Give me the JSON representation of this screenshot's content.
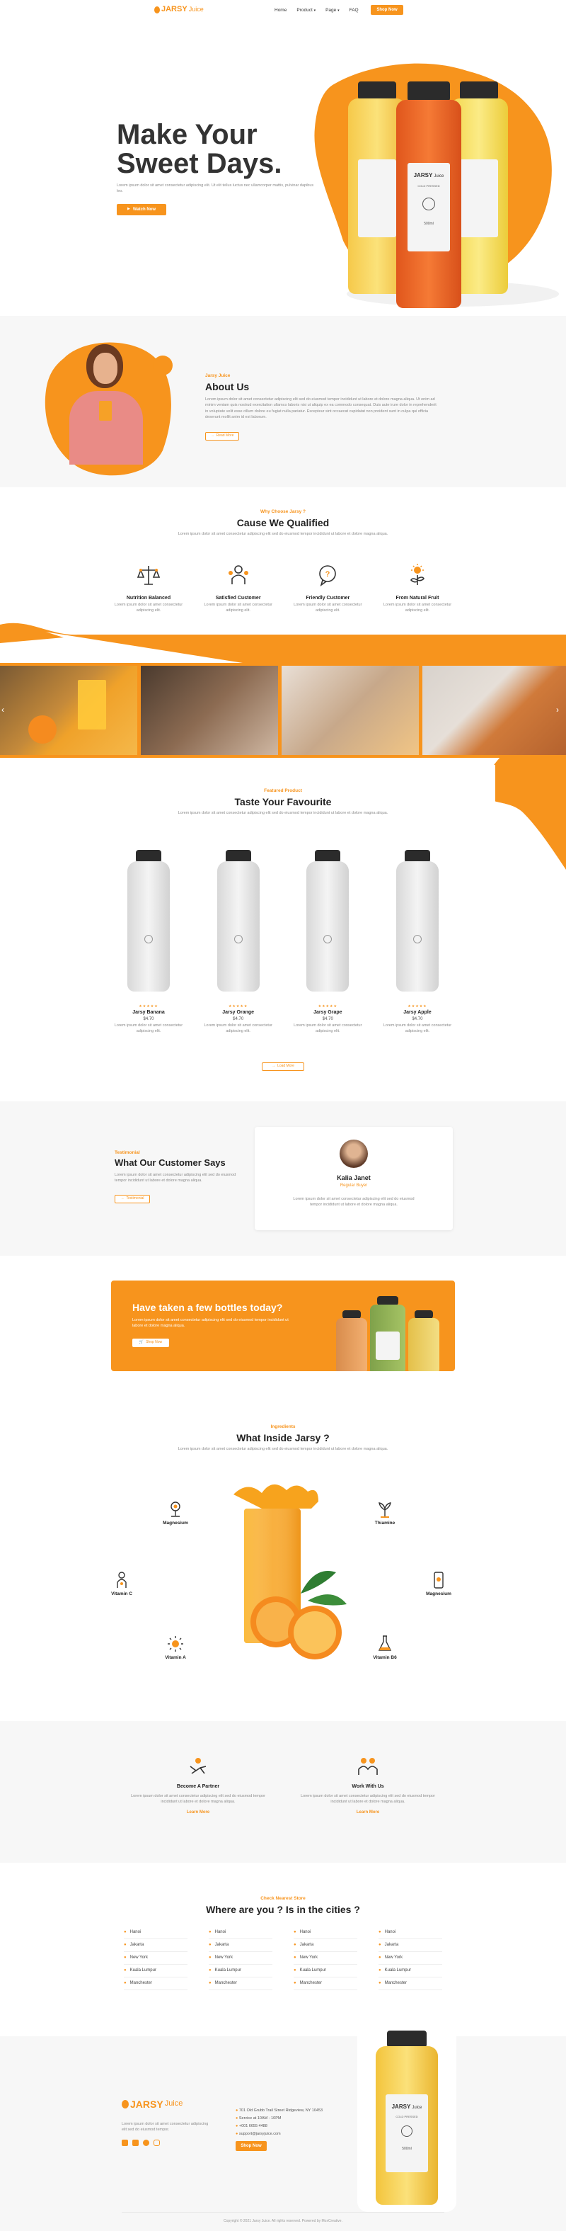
{
  "brand": {
    "name_main": "JARSY",
    "name_sub": "Juice"
  },
  "nav": {
    "items": [
      {
        "label": "Home"
      },
      {
        "label": "Product",
        "caret": true
      },
      {
        "label": "Page",
        "caret": true
      },
      {
        "label": "FAQ"
      }
    ],
    "cta": "Shop Now"
  },
  "hero": {
    "title_line1": "Make Your",
    "title_line2": "Sweet Days.",
    "body": "Lorem ipsum dolor sit amet consectetur adipiscing elit. Ut elit tellus luctus nec ullamcorper mattis, pulvinar dapibus leo.",
    "button": "Watch Now",
    "bottle_label": "COLD PRESSED",
    "bottle_volume": "500ml"
  },
  "about": {
    "kicker": "Jarsy Juice",
    "title": "About Us",
    "body": "Lorem ipsum dolor sit amet consectetur adipiscing elit sed do eiusmod tempor incididunt ut labore et dolore magna aliqua. Ut enim ad minim veniam quis nostrud exercitation ullamco laboris nisi ut aliquip ex ea commodo consequat. Duis aute irure dolor in reprehenderit in voluptate velit esse cillum dolore eu fugiat nulla pariatur. Excepteur sint occaecat cupidatat non proident sunt in culpa qui officia deserunt mollit anim id est laborum.",
    "button": "Read More"
  },
  "why": {
    "kicker": "Why Choose Jarsy ?",
    "title": "Cause We Qualified",
    "body": "Lorem ipsum dolor sit amet consectetur adipiscing elit sed do eiusmod tempor incididunt ut labore et dolore magna aliqua.",
    "features": [
      {
        "icon": "balance-icon",
        "title": "Nutrition Balanced",
        "text": "Lorem ipsum dolor sit amet consectetur adipiscing elit."
      },
      {
        "icon": "customers-icon",
        "title": "Satisfied Customer",
        "text": "Lorem ipsum dolor sit amet consectetur adipiscing elit."
      },
      {
        "icon": "chat-icon",
        "title": "Friendly Customer",
        "text": "Lorem ipsum dolor sit amet consectetur adipiscing elit."
      },
      {
        "icon": "sun-plant-icon",
        "title": "From Natural Fruit",
        "text": "Lorem ipsum dolor sit amet consectetur adipiscing elit."
      }
    ]
  },
  "gallery": {
    "prev": "‹",
    "next": "›"
  },
  "products": {
    "kicker": "Featured Product",
    "title": "Taste Your Favourite",
    "body": "Lorem ipsum dolor sit amet consectetur adipiscing elit sed do eiusmod tempor incididunt ut labore et dolore magna aliqua.",
    "items": [
      {
        "name": "Jarsy Banana",
        "price": "$4.70",
        "stars": "★★★★★",
        "text": "Lorem ipsum dolor sit amet consectetur adipiscing elit."
      },
      {
        "name": "Jarsy Orange",
        "price": "$4.70",
        "stars": "★★★★★",
        "text": "Lorem ipsum dolor sit amet consectetur adipiscing elit."
      },
      {
        "name": "Jarsy Grape",
        "price": "$4.70",
        "stars": "★★★★★",
        "text": "Lorem ipsum dolor sit amet consectetur adipiscing elit."
      },
      {
        "name": "Jarsy Apple",
        "price": "$4.70",
        "stars": "★★★★★",
        "text": "Lorem ipsum dolor sit amet consectetur adipiscing elit."
      }
    ],
    "button": "Load More"
  },
  "testimonial": {
    "kicker": "Testimonial",
    "title": "What Our Customer Says",
    "body": "Lorem ipsum dolor sit amet consectetur adipiscing elit sed do eiusmod tempor incididunt ut labore et dolore magna aliqua.",
    "button": "Testimonial",
    "name": "Kalia Janet",
    "role": "Regular Buyer",
    "quote": "Lorem ipsum dolor sit amet consectetur adipiscing elit sed do eiusmod tempor incididunt ut labore et dolore magna aliqua."
  },
  "cta": {
    "title": "Have taken a few bottles today?",
    "body": "Lorem ipsum dolor sit amet consectetur adipiscing elit sed do eiusmod tempor incididunt ut labore et dolore magna aliqua.",
    "button": "Shop Now"
  },
  "ingredients": {
    "kicker": "Ingredients",
    "title": "What Inside Jarsy ?",
    "body": "Lorem ipsum dolor sit amet consectetur adipiscing elit sed do eiusmod tempor incididunt ut labore et dolore magna aliqua.",
    "left": [
      "Magnesium",
      "Vitamin C",
      "Vitamin A"
    ],
    "right": [
      "Thiamine",
      "Magnesium",
      "Vitamin B6"
    ]
  },
  "partner": {
    "items": [
      {
        "title": "Become A Partner",
        "text": "Lorem ipsum dolor sit amet consectetur adipiscing elit sed do eiusmod tempor incididunt ut labore et dolore magna aliqua.",
        "link": "Learn More"
      },
      {
        "title": "Work With Us",
        "text": "Lorem ipsum dolor sit amet consectetur adipiscing elit sed do eiusmod tempor incididunt ut labore et dolore magna aliqua.",
        "link": "Learn More"
      }
    ]
  },
  "cities": {
    "kicker": "Check Nearest Store",
    "title": "Where are you ? Is in the cities ?",
    "columns": [
      [
        "Hanoi",
        "Jakarta",
        "New York",
        "Kuala Lumpur",
        "Manchester"
      ],
      [
        "Hanoi",
        "Jakarta",
        "New York",
        "Kuala Lumpur",
        "Manchester"
      ],
      [
        "Hanoi",
        "Jakarta",
        "New York",
        "Kuala Lumpur",
        "Manchester"
      ],
      [
        "Hanoi",
        "Jakarta",
        "New York",
        "Kuala Lumpur",
        "Manchester"
      ]
    ]
  },
  "footer": {
    "body": "Lorem ipsum dolor sit amet consectetur adipiscing elit sed do eiusmod tempor.",
    "address": "701 Old Grubb Trail Street Ridgeview, NY 10453",
    "hours": "Service at 10AM - 10PM",
    "phone": "+001 6655 4488",
    "email": "support@jarsyjuice.com",
    "button": "Shop Now",
    "copyright": "Copyright © 2021 Jarsy Juice. All rights reserved. Powered by MoxCreative."
  }
}
